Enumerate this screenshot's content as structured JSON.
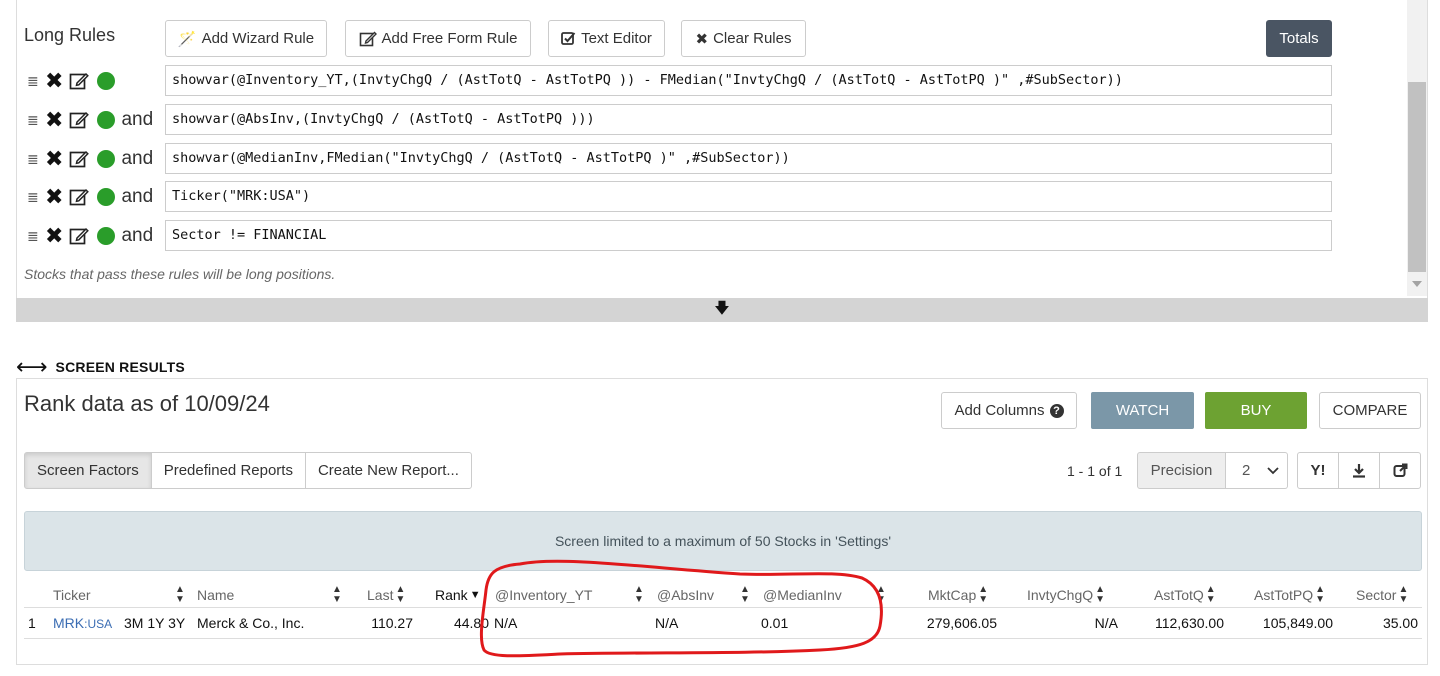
{
  "rules": {
    "title": "Long Rules",
    "toolbar": {
      "add_wizard": "Add Wizard Rule",
      "add_free_form": "Add Free Form Rule",
      "text_editor": "Text Editor",
      "clear_rules": "Clear Rules",
      "totals": "Totals"
    },
    "items": [
      {
        "connector": "",
        "formula": "showvar(@Inventory_YT,(InvtyChgQ / (AstTotQ - AstTotPQ )) - FMedian(\"InvtyChgQ / (AstTotQ - AstTotPQ )\" ,#SubSector))"
      },
      {
        "connector": "and",
        "formula": "showvar(@AbsInv,(InvtyChgQ / (AstTotQ - AstTotPQ )))"
      },
      {
        "connector": "and",
        "formula": "showvar(@MedianInv,FMedian(\"InvtyChgQ / (AstTotQ - AstTotPQ )\" ,#SubSector))"
      },
      {
        "connector": "and",
        "formula": "Ticker(\"MRK:USA\")"
      },
      {
        "connector": "and",
        "formula": "Sector != FINANCIAL"
      }
    ],
    "note": "Stocks that pass these rules will be long positions."
  },
  "results": {
    "section_label": "SCREEN RESULTS",
    "title": "Rank data as of 10/09/24",
    "add_columns": "Add Columns",
    "watch": "WATCH",
    "buy": "BUY",
    "compare": "COMPARE",
    "tabs": [
      "Screen Factors",
      "Predefined Reports",
      "Create New Report..."
    ],
    "paging": "1 - 1 of 1",
    "precision_label": "Precision",
    "precision_value": "2",
    "yahoo_label": "Y!",
    "info": "Screen limited to a maximum of 50 Stocks in 'Settings'",
    "columns": [
      "Ticker",
      "Name",
      "Last",
      "Rank",
      "@Inventory_YT",
      "@AbsInv",
      "@MedianInv",
      "MktCap",
      "InvtyChgQ",
      "AstTotQ",
      "AstTotPQ",
      "Sector"
    ],
    "row": {
      "num": "1",
      "ticker": "MRK",
      "exchange": ":USA",
      "periods": "3M 1Y 3Y",
      "name": "Merck & Co., Inc.",
      "last": "110.27",
      "rank": "44.80",
      "inventory_yt": "N/A",
      "absinv": "N/A",
      "medianinv": "0.01",
      "mktcap": "279,606.05",
      "invtychgq": "N/A",
      "asttotq": "112,630.00",
      "asttotpq": "105,849.00",
      "sector": "35.00"
    }
  },
  "colors": {
    "totals_bg": "#4a5563",
    "watch_bg": "#7b97a8",
    "buy_bg": "#6da232",
    "status_dot": "#2a9d2a",
    "annotation": "#e0191b"
  },
  "icons": [
    "wand-icon",
    "edit-icon",
    "check-edit-icon",
    "close-icon",
    "drag-handle-icon",
    "question-icon",
    "download-icon",
    "external-link-icon",
    "arrow-down-icon",
    "left-right-arrows-icon"
  ]
}
